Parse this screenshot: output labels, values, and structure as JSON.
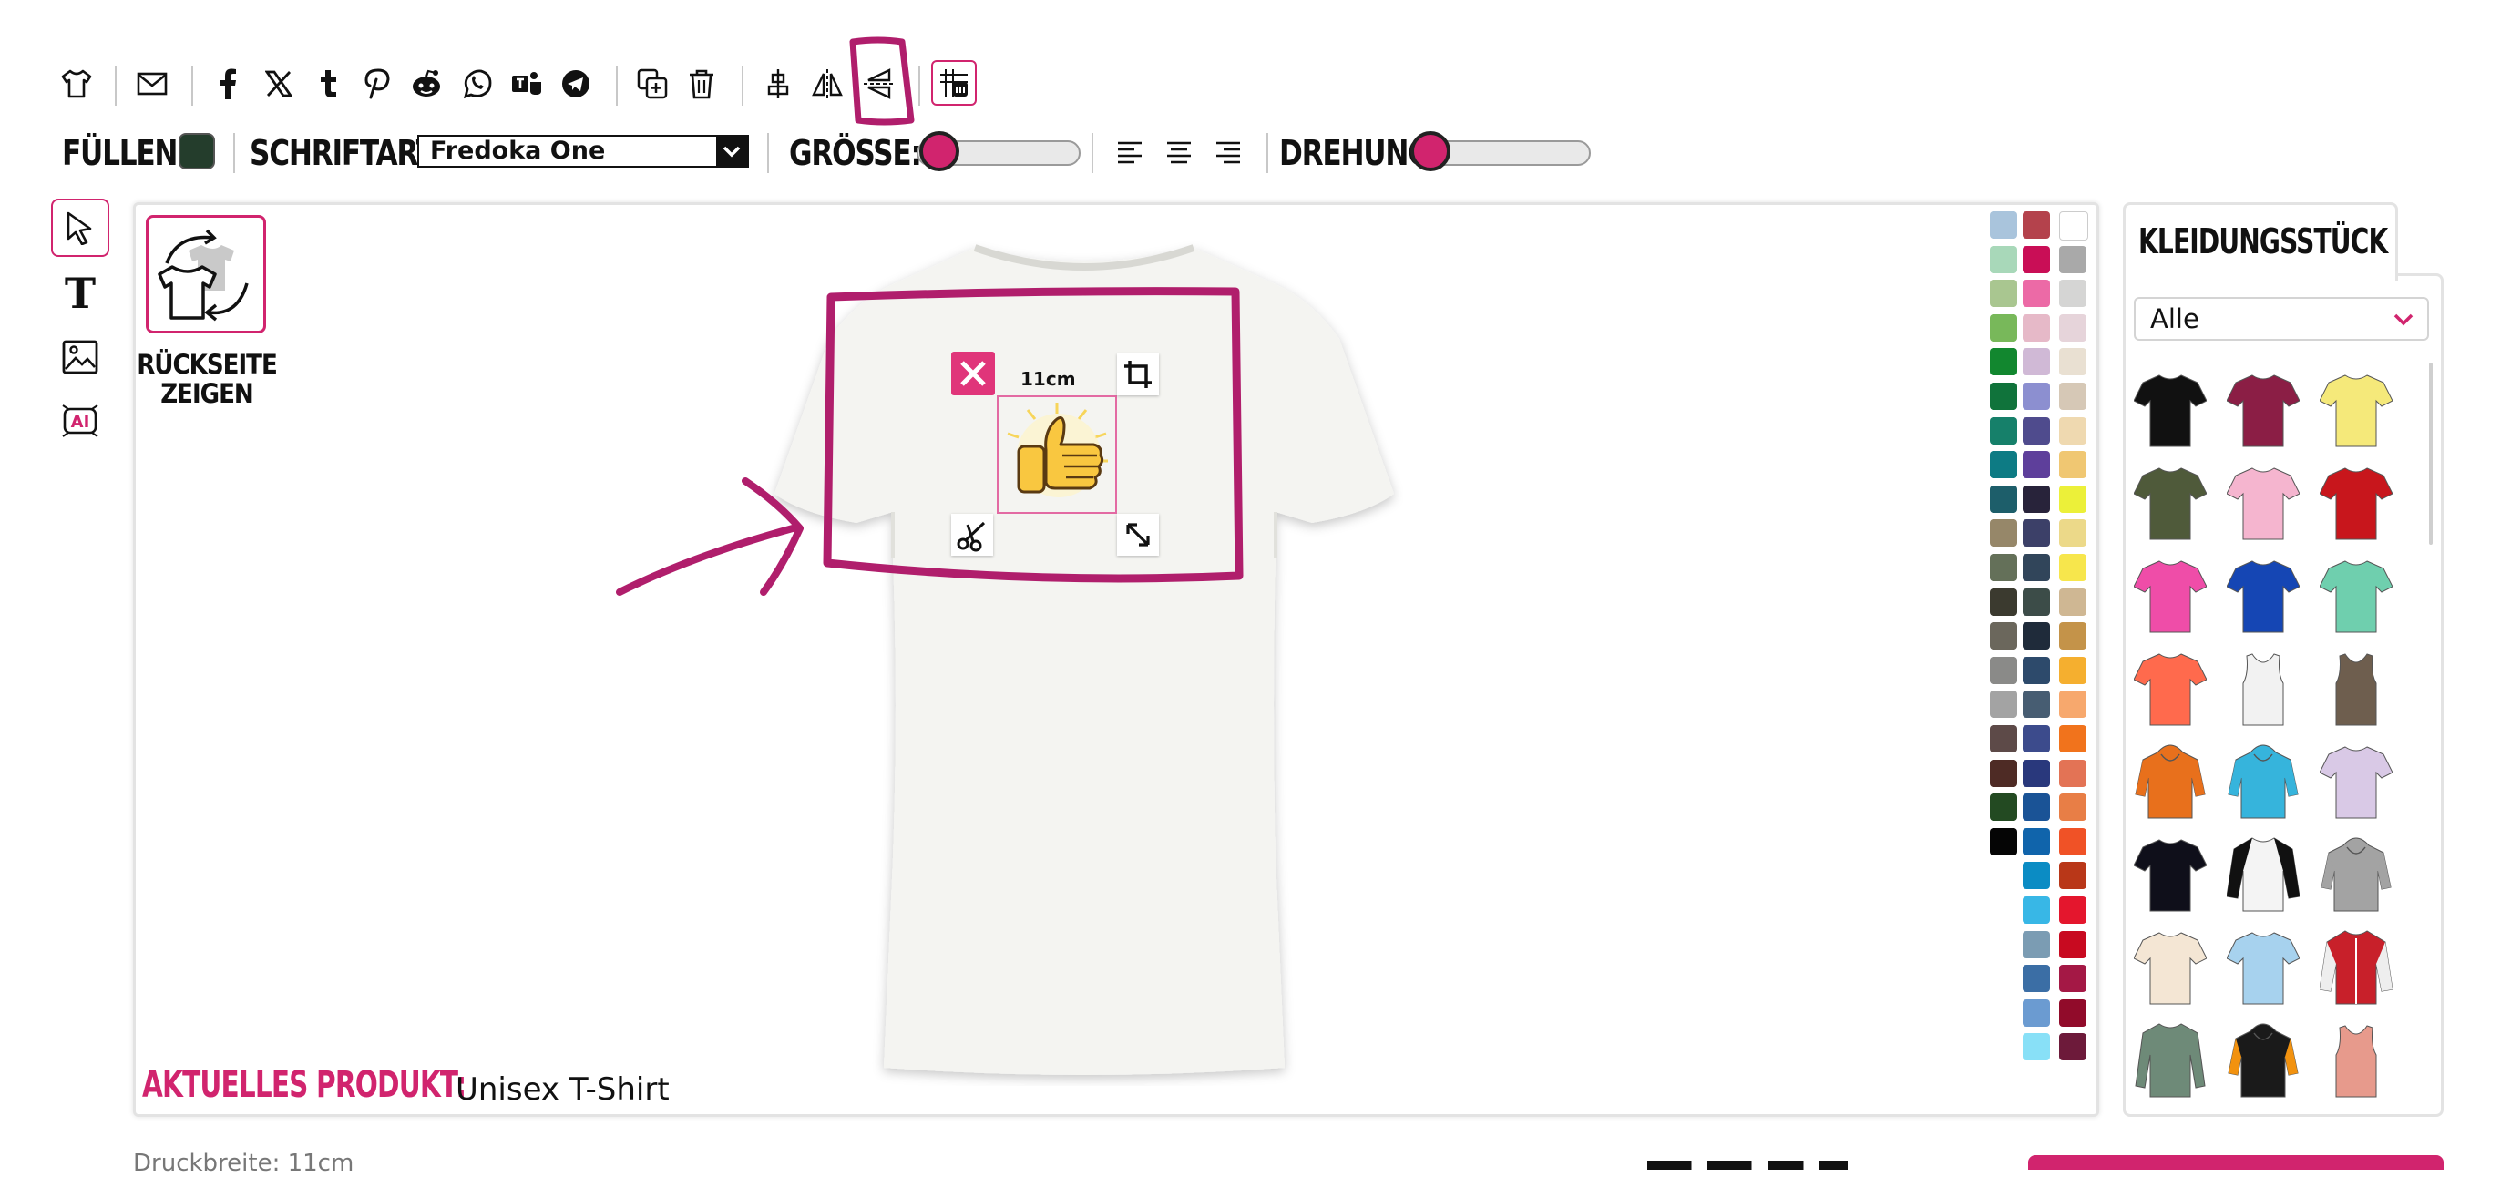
{
  "toolbar": {
    "icons": [
      "tshirt-icon",
      "mail-icon",
      "facebook-icon",
      "x-icon",
      "tumblr-icon",
      "pinterest-icon",
      "reddit-icon",
      "whatsapp-icon",
      "teams-icon",
      "telegram-icon",
      "duplicate-icon",
      "trash-icon",
      "align-center-icon",
      "flip-horizontal-icon",
      "flip-vertical-icon",
      "grid-icon"
    ]
  },
  "options": {
    "fill_label": "FÜLLEN:",
    "fill_color": "#243d2c",
    "font_label": "SCHRIFTART:",
    "font_value": "Fredoka One",
    "size_label": "GRÖSSE:",
    "size_value": 0.05,
    "rotation_label": "DREHUNG:",
    "rotation_value": 0.0
  },
  "tools": [
    "select-tool",
    "text-tool",
    "image-tool",
    "ai-tool"
  ],
  "canvas": {
    "backside_label_1": "RÜCKSEITE",
    "backside_label_2": "ZEIGEN",
    "current_product_label": "AKTUELLES PRODUKT:",
    "current_product_value": "Unisex T-Shirt",
    "design_width_tag": "11cm",
    "accent": "#d1246e",
    "annotation_color": "#b01e6c"
  },
  "palette": {
    "col1": [
      "#a9c4dc",
      "#a8d8b9",
      "#a9c690",
      "#78b85a",
      "#12872f",
      "#10733b",
      "#16806a",
      "#0d7b84",
      "#1d5e6a",
      "#968769",
      "#647059",
      "#3b3a2f",
      "#6b675c",
      "#8a8a88",
      "#a3a3a3",
      "#5d4a48",
      "#4e2b25",
      "#234a22",
      "#050505"
    ],
    "col2": [
      "#b4424c",
      "#c90e56",
      "#ec6aa6",
      "#e6b9c8",
      "#d0b9d6",
      "#8c8fd0",
      "#4f4b8d",
      "#5e3f9b",
      "#28233a",
      "#3c4068",
      "#31455a",
      "#3c4c48",
      "#1f2b3a",
      "#2d4a6b",
      "#475d72",
      "#3c4b8c",
      "#29387c",
      "#1a5396",
      "#1064ab",
      "#0b8cc4",
      "#38b7e6",
      "#7b9cb3",
      "#3b6ea5",
      "#6b9bd1",
      "#88e0f7"
    ],
    "col3": [
      "#ffffff",
      "#a9a9a9",
      "#d5d5d4",
      "#e6d4da",
      "#e9e0d2",
      "#d6c8b6",
      "#efd9b0",
      "#f0c772",
      "#ecf039",
      "#ecd989",
      "#f7e64c",
      "#cfb793",
      "#c49349",
      "#f5af2f",
      "#f7a86d",
      "#f1731c",
      "#e37355",
      "#e87e46",
      "#f05226",
      "#b93718",
      "#e4162d",
      "#c80a20",
      "#a41845",
      "#910b2a",
      "#6d1a3a"
    ]
  },
  "sidebar": {
    "tab_label": "KLEIDUNGSSTÜCK",
    "filter_value": "Alle",
    "thumbs": [
      {
        "c": "#111111",
        "t": "tee"
      },
      {
        "c": "#8b1e45",
        "t": "tee"
      },
      {
        "c": "#f5e97a",
        "t": "tee"
      },
      {
        "c": "#4f5a3a",
        "t": "tee"
      },
      {
        "c": "#f5b5cf",
        "t": "tee"
      },
      {
        "c": "#c8161c",
        "t": "tee"
      },
      {
        "c": "#ef4da8",
        "t": "tee"
      },
      {
        "c": "#1546b4",
        "t": "tee"
      },
      {
        "c": "#6fcfae",
        "t": "tee"
      },
      {
        "c": "#ff6a4d",
        "t": "tee"
      },
      {
        "c": "#f2f2f2",
        "t": "tank"
      },
      {
        "c": "#6e5e4e",
        "t": "tank"
      },
      {
        "c": "#e8701c",
        "t": "hood"
      },
      {
        "c": "#36b4dc",
        "t": "hood"
      },
      {
        "c": "#d9c9e6",
        "t": "tee"
      },
      {
        "c": "#0f0f1a",
        "t": "tee"
      },
      {
        "c": "#f4f4f4",
        "t": "raglan"
      },
      {
        "c": "#a3a3a3",
        "t": "hood"
      },
      {
        "c": "#f4e6d4",
        "t": "tee"
      },
      {
        "c": "#a7d2ee",
        "t": "tee"
      },
      {
        "c": "#c8202a",
        "t": "jacket"
      },
      {
        "c": "#6e8a78",
        "t": "long"
      },
      {
        "c": "#1a1a1a",
        "t": "hoodorange"
      },
      {
        "c": "#e79a8c",
        "t": "tank"
      }
    ]
  },
  "footer": {
    "print_width": "Druckbreite: 11cm"
  }
}
